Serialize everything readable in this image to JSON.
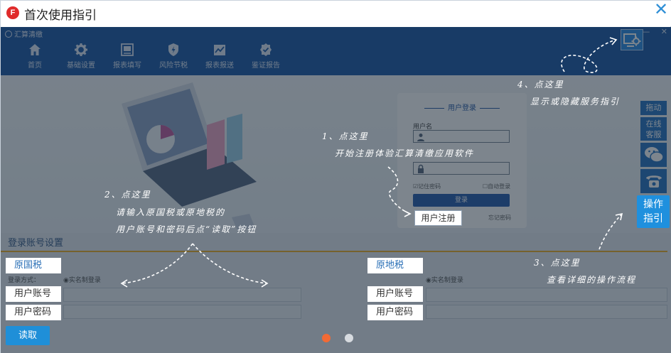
{
  "guide": {
    "title": "首次使用指引",
    "logo_letter": "F",
    "close_glyph": "✕"
  },
  "app": {
    "name": "汇算清缴",
    "window_controls": [
      "—",
      "✕"
    ],
    "nav": [
      {
        "label": "首页",
        "icon": "home-icon"
      },
      {
        "label": "基础设置",
        "icon": "gear-icon"
      },
      {
        "label": "报表填写",
        "icon": "report-fill-icon"
      },
      {
        "label": "风险节税",
        "icon": "shield-icon"
      },
      {
        "label": "报表报送",
        "icon": "chart-upload-icon"
      },
      {
        "label": "鉴证报告",
        "icon": "badge-icon"
      }
    ],
    "settings_icon": "settings-monitor-icon",
    "login": {
      "title": "用户登录",
      "username_label": "用户名",
      "remember_label": "☑记住密码",
      "autologin_label": "☐自动登录",
      "login_button": "登录",
      "forgot_label": "忘记密码",
      "register_button": "用户注册"
    },
    "side_tools": {
      "drag": "拖动",
      "online_line1": "在线",
      "online_line2": "客服",
      "wechat_icon": "wechat-icon",
      "phone_icon": "phone-icon",
      "guide_line1": "操作",
      "guide_line2": "指引"
    },
    "account": {
      "section_title": "登录账号设置",
      "national_tax": "原国税",
      "local_tax": "原地税",
      "login_mode_left": "登录方式：",
      "login_mode_option": "◉实名制登录",
      "username_field": "用户账号",
      "password_field": "用户密码",
      "read_button": "读取"
    }
  },
  "annotations": {
    "step1_title": "1、点这里",
    "step1_text": "开始注册体验汇算清缴应用软件",
    "step2_title": "2、点这里",
    "step2_line1": "请输入原国税或原地税的",
    "step2_line2": "用户账号和密码后点“读取”按钮",
    "step3_title": "3、点这里",
    "step3_text": "查看详细的操作流程",
    "step4_title": "4、点这里",
    "step4_text": "显示或隐藏服务指引"
  },
  "pager": {
    "total": 2,
    "current": 1,
    "active_color": "#f26a35",
    "inactive_color": "#d7dbe0"
  }
}
